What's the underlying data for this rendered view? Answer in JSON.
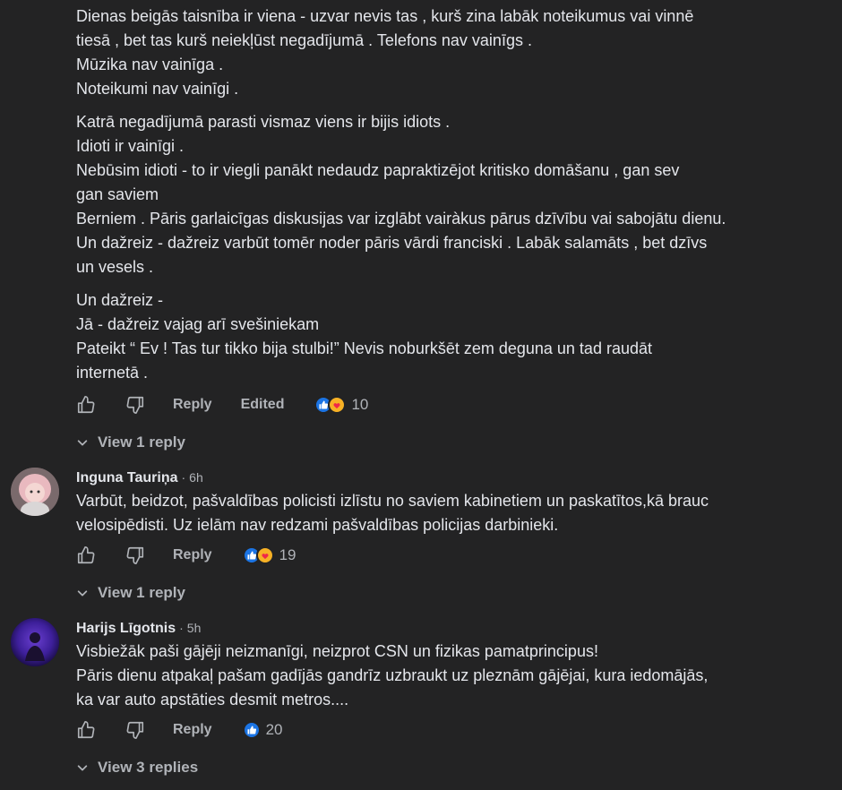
{
  "comment1": {
    "paragraphs": [
      [
        "Dienas beigās taisnība ir viena - uzvar nevis tas , kurš zina labāk noteikumus vai vinnē",
        "tiesā , bet tas kurš neiekļūst negadījumā . Telefons nav vainīgs .",
        "Mūzika nav vainīga .",
        "Noteikumi nav vainīgi ."
      ],
      [
        "Katrā negadījumā parasti vismaz viens ir bijis idiots .",
        "Idioti ir vainīgi .",
        "Nebūsim idioti - to ir viegli panākt nedaudz papraktizējot kritisko domāšanu , gan sev",
        "gan saviem",
        "Berniem . Pāris garlaicīgas diskusijas var izglābt vairàkus pārus dzīvību vai sabojātu dienu.",
        "Un dažreiz - dažreiz varbūt tomēr noder pāris vārdi franciski . Labāk salamāts , bet dzīvs",
        "un vesels ."
      ],
      [
        "Un dažreiz -",
        "Jā - dažreiz vajag arī svešiniekam",
        "Pateikt “ Ev ! Tas tur tikko bija stulbi!” Nevis noburkšēt zem deguna un tad raudāt",
        "internetā ."
      ]
    ],
    "reply_label": "Reply",
    "edited_label": "Edited",
    "reaction_count": "10",
    "view_replies": "View 1 reply"
  },
  "comment2": {
    "author": "Inguna Tauriņa",
    "time": "6h",
    "lines": [
      "Varbūt, beidzot, pašvaldības policisti izlīstu no saviem kabinetiem un paskatītos,kā brauc",
      "velosipēdisti. Uz ielām nav redzami pašvaldības policijas darbinieki."
    ],
    "reply_label": "Reply",
    "reaction_count": "19",
    "view_replies": "View 1 reply"
  },
  "comment3": {
    "author": "Harijs Līgotnis",
    "time": "5h",
    "lines": [
      "Visbiežāk paši gājēji neizmanīgi, neizprot CSN un fizikas pamatprincipus!",
      "Pāris dienu atpakaļ pašam gadījās gandrīz uzbraukt uz pleznām gājējai, kura iedomājās,",
      "ka var auto apstāties desmit metros...."
    ],
    "reply_label": "Reply",
    "reaction_count": "20",
    "view_replies": "View 3 replies"
  },
  "icons": {
    "like": "thumbs-up-outline-icon",
    "dislike": "thumbs-down-outline-icon",
    "chevron": "chevron-down-icon",
    "like_reaction": "like-reaction-icon",
    "care_reaction": "care-reaction-icon"
  },
  "colors": {
    "background": "#232324",
    "text": "#e4e6eb",
    "secondary": "#b0b3b8",
    "like_blue": "#1b74e4",
    "care_yellow": "#f7b125"
  }
}
